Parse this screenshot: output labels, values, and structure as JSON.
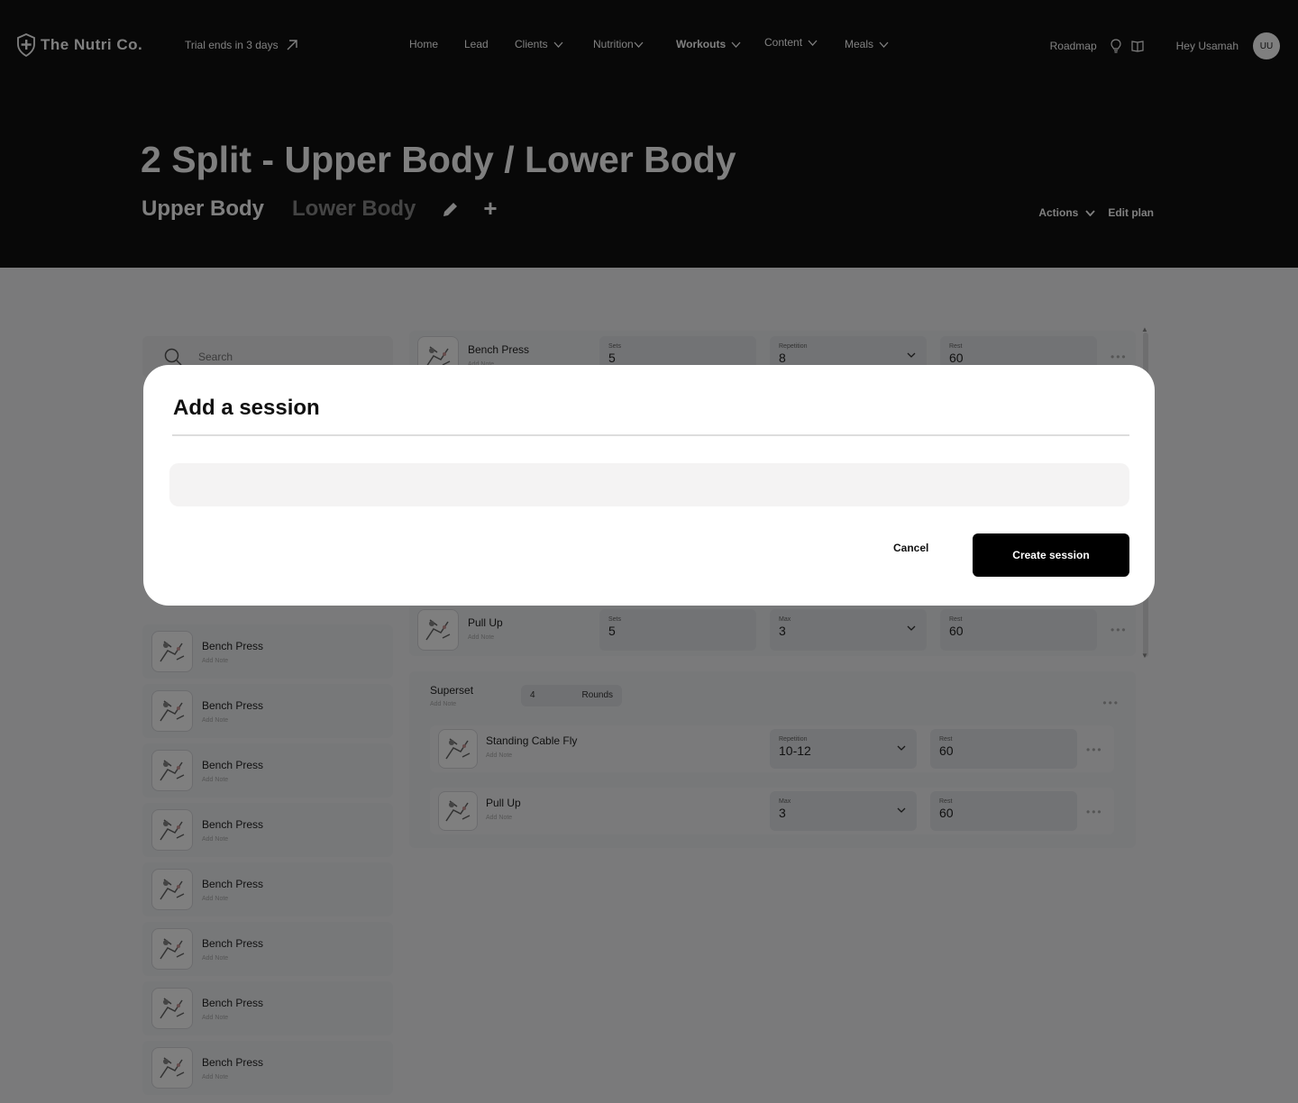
{
  "nav": {
    "brand": "The Nutri Co.",
    "trial": "Trial ends in 3 days",
    "links": [
      "Home",
      "Lead",
      "Clients",
      "Nutrition",
      "Workouts",
      "Content",
      "Meals"
    ],
    "roadmap": "Roadmap",
    "greeting": "Hey Usamah",
    "avatar_initials": "UU"
  },
  "plan": {
    "title": "2 Split - Upper Body / Lower Body",
    "tabs": [
      "Upper Body",
      "Lower Body"
    ],
    "actions_label": "Actions",
    "edit_label": "Edit plan"
  },
  "sidebar": {
    "search_placeholder": "Search",
    "items": [
      {
        "name": "Bench Press",
        "note": "Add Note"
      },
      {
        "name": "Bench Press",
        "note": "Add Note"
      },
      {
        "name": "Bench Press",
        "note": "Add Note"
      },
      {
        "name": "Bench Press",
        "note": "Add Note"
      },
      {
        "name": "Bench Press",
        "note": "Add Note"
      },
      {
        "name": "Bench Press",
        "note": "Add Note"
      },
      {
        "name": "Bench Press",
        "note": "Add Note"
      },
      {
        "name": "Bench Press",
        "note": "Add Note"
      }
    ]
  },
  "exercises": [
    {
      "name": "Bench Press",
      "note": "Add Note",
      "sets_label": "Sets",
      "sets": "5",
      "rep_label": "Repetition",
      "rep": "8",
      "rest_label": "Rest",
      "rest": "60"
    },
    {
      "name": "Pull Up",
      "note": "Add Note",
      "sets_label": "Sets",
      "sets": "5",
      "rep_label": "Max",
      "rep": "3",
      "rest_label": "Rest",
      "rest": "60"
    }
  ],
  "superset": {
    "title": "Superset",
    "note": "Add Note",
    "rounds_value": "4",
    "rounds_label": "Rounds",
    "items": [
      {
        "name": "Standing Cable Fly",
        "note": "Add Note",
        "rep_label": "Repetition",
        "rep": "10-12",
        "rest_label": "Rest",
        "rest": "60"
      },
      {
        "name": "Pull Up",
        "note": "Add Note",
        "rep_label": "Max",
        "rep": "3",
        "rest_label": "Rest",
        "rest": "60"
      }
    ]
  },
  "modal": {
    "title": "Add a session",
    "input_value": "",
    "cancel_label": "Cancel",
    "create_label": "Create session"
  },
  "colors": {
    "header_bg": "#111111",
    "page_bg": "#f5f5f7",
    "primary_button": "#000000",
    "overlay": "rgba(0,0,0,0.5)"
  }
}
